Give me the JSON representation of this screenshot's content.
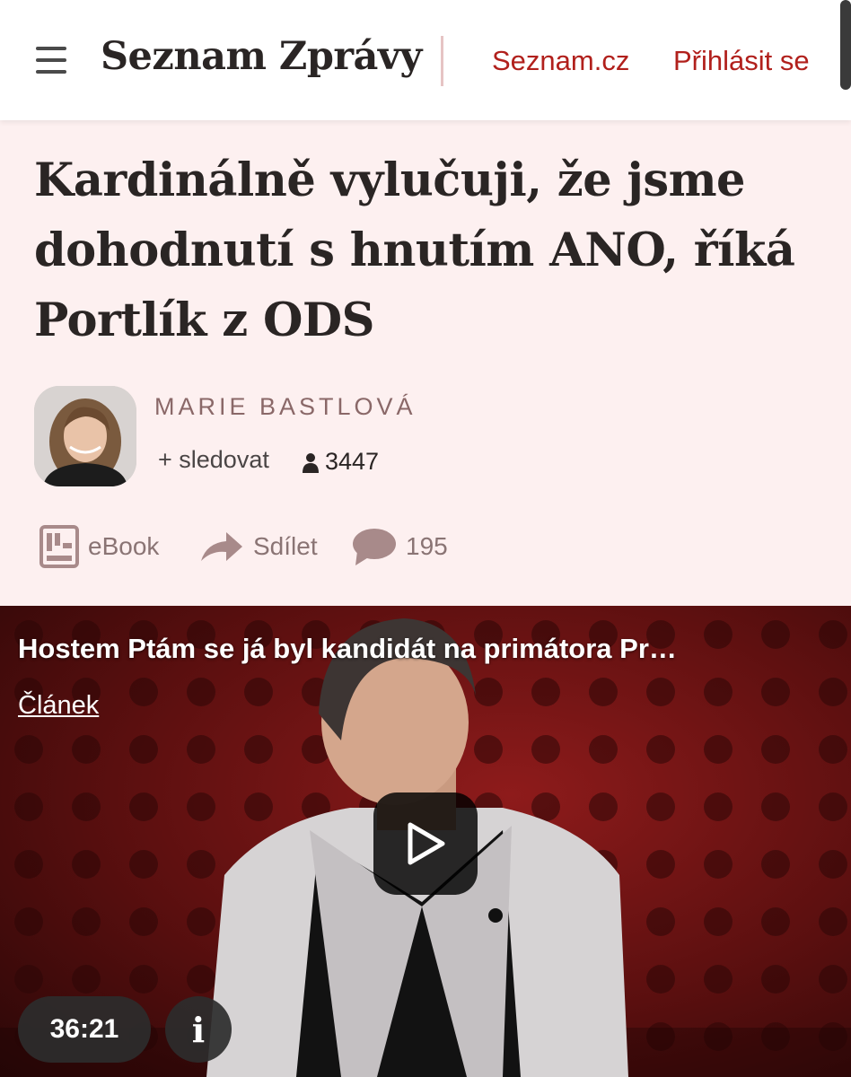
{
  "header": {
    "brand": "Seznam Zprávy",
    "link_seznam": "Seznam.cz",
    "link_login": "Přihlásit se"
  },
  "article": {
    "title": "Kardinálně vylučuji, že jsme dohodnutí s hnutím ANO, říká Portlík z ODS",
    "author": {
      "name": "MARIE BASTLOVÁ",
      "follow_label": "+ sledovat",
      "followers": "3447"
    },
    "actions": {
      "ebook": "eBook",
      "share": "Sdílet",
      "comments": "195"
    }
  },
  "video": {
    "title": "Hostem Ptám se já byl kandidát na primátora Pr…",
    "tag": "Článek",
    "duration": "36:21",
    "info": "i"
  },
  "colors": {
    "accent": "#b1201c",
    "page_background": "#fdf0f0",
    "action_icon": "#a88a8a"
  },
  "icons": [
    "menu-icon",
    "person-icon",
    "ebook-icon",
    "share-arrow-icon",
    "comment-bubble-icon",
    "play-icon",
    "info-icon"
  ]
}
